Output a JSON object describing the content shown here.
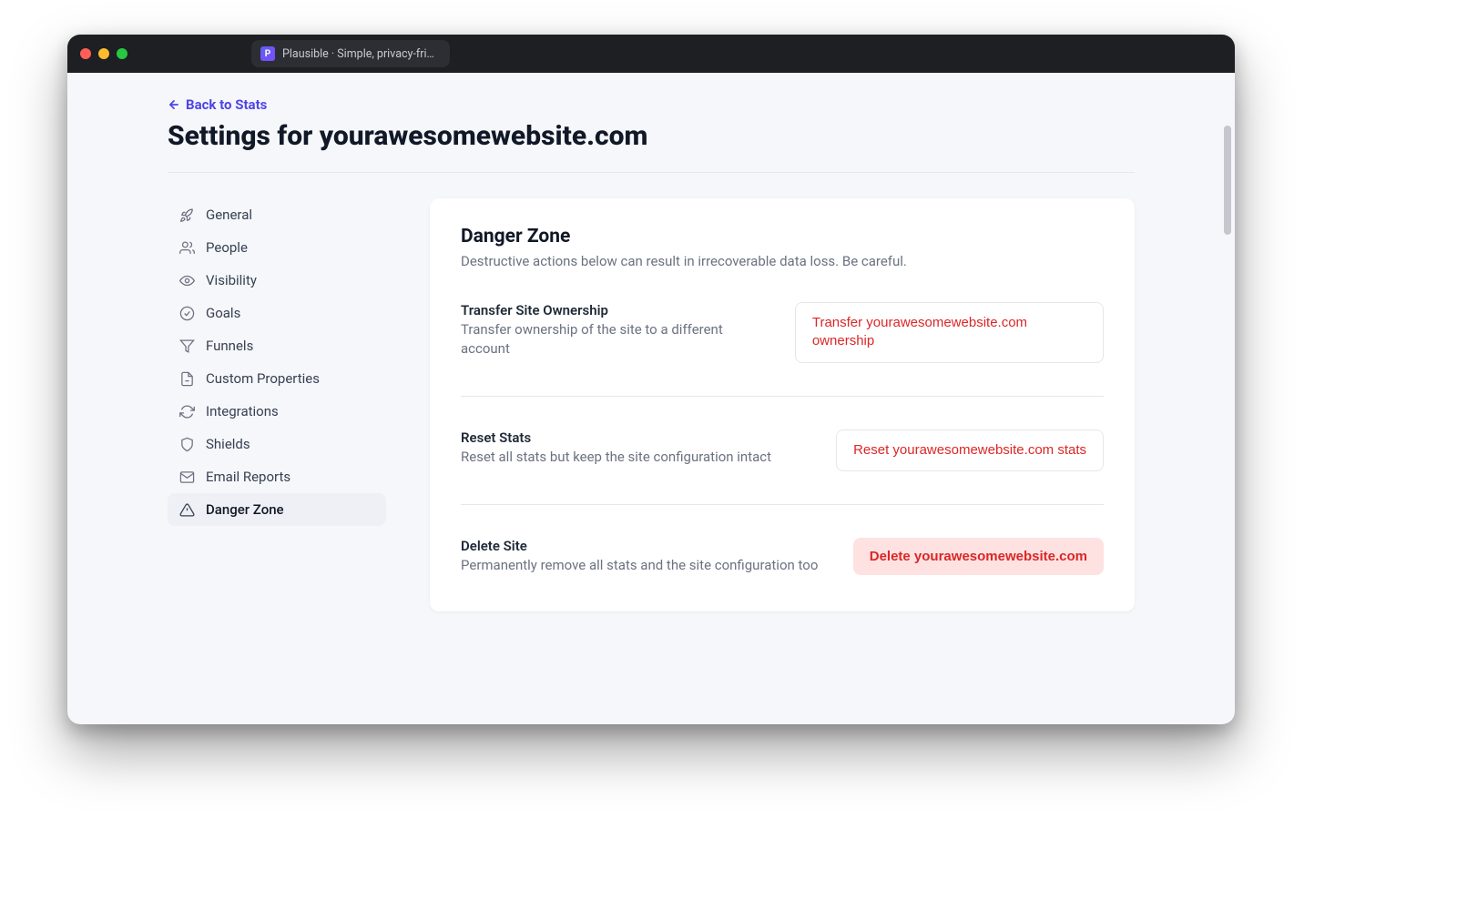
{
  "browser": {
    "tab_title": "Plausible · Simple, privacy-frien"
  },
  "header": {
    "back_label": "Back to Stats",
    "title": "Settings for yourawesomewebsite.com"
  },
  "sidebar": {
    "items": [
      {
        "label": "General",
        "icon": "rocket-icon",
        "active": false
      },
      {
        "label": "People",
        "icon": "users-icon",
        "active": false
      },
      {
        "label": "Visibility",
        "icon": "eye-icon",
        "active": false
      },
      {
        "label": "Goals",
        "icon": "check-circle-icon",
        "active": false
      },
      {
        "label": "Funnels",
        "icon": "funnel-icon",
        "active": false
      },
      {
        "label": "Custom Properties",
        "icon": "document-icon",
        "active": false
      },
      {
        "label": "Integrations",
        "icon": "refresh-icon",
        "active": false
      },
      {
        "label": "Shields",
        "icon": "shield-icon",
        "active": false
      },
      {
        "label": "Email Reports",
        "icon": "mail-icon",
        "active": false
      },
      {
        "label": "Danger Zone",
        "icon": "alert-triangle-icon",
        "active": true
      }
    ]
  },
  "panel": {
    "title": "Danger Zone",
    "subtitle": "Destructive actions below can result in irrecoverable data loss. Be careful.",
    "transfer": {
      "title": "Transfer Site Ownership",
      "desc": "Transfer ownership of the site to a different account",
      "button": "Transfer yourawesomewebsite.com ownership"
    },
    "reset": {
      "title": "Reset Stats",
      "desc": "Reset all stats but keep the site configuration intact",
      "button": "Reset yourawesomewebsite.com stats"
    },
    "del": {
      "title": "Delete Site",
      "desc": "Permanently remove all stats and the site configuration too",
      "button": "Delete yourawesomewebsite.com"
    }
  },
  "colors": {
    "accent": "#4F46E5",
    "danger": "#DC2626",
    "danger_bg": "#FEE2E2",
    "page_bg": "#F6F7FB",
    "titlebar_bg": "#1E1F23"
  }
}
